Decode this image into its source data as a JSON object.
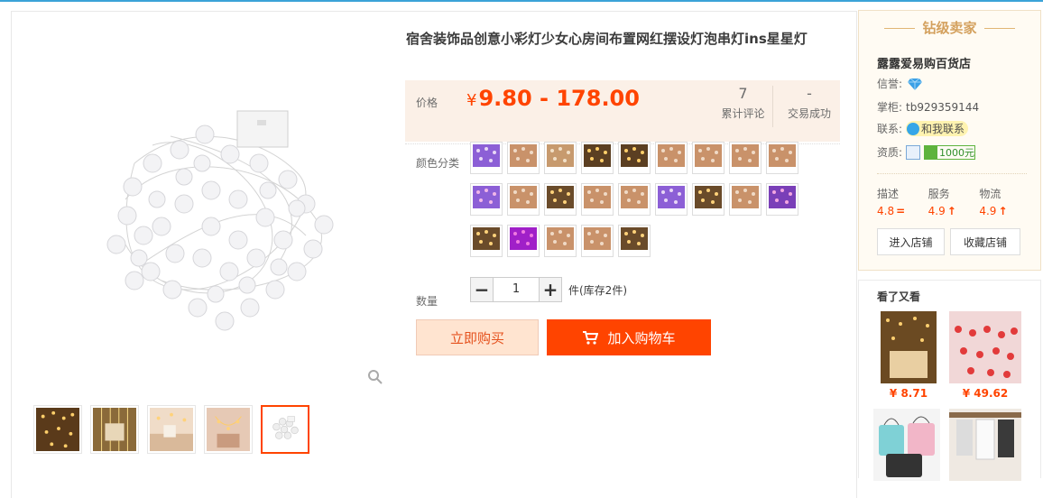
{
  "product": {
    "title": "宿舍装饰品创意小彩灯少女心房间布置网红摆设灯泡串灯ins星星灯",
    "price_label": "价格",
    "currency": "¥",
    "price_range": "9.80 - 178.00",
    "reviews_count": "7",
    "reviews_label": "累计评论",
    "sales_value": "-",
    "sales_label": "交易成功",
    "sku_label": "颜色分类",
    "sku_count": 23,
    "quantity_label": "数量",
    "quantity_value": "1",
    "stock_text": "件(库存2件)",
    "buy_now_label": "立即购买",
    "add_to_cart_label": "加入购物车"
  },
  "gallery": {
    "thumb_count": 5,
    "active_thumb_index": 4
  },
  "seller": {
    "badge": "钻级卖家",
    "shop_name": "露露爱易购百货店",
    "credit_label": "信誉:",
    "owner_label": "掌柜:",
    "owner": "tb929359144",
    "contact_label": "联系:",
    "contact_button": "和我联系",
    "qualification_label": "资质:",
    "deposit": "1000元",
    "scores": [
      {
        "label": "描述",
        "value": "4.8",
        "trend": "="
      },
      {
        "label": "服务",
        "value": "4.9",
        "trend": "↑"
      },
      {
        "label": "物流",
        "value": "4.9",
        "trend": "↑"
      }
    ],
    "enter_shop": "进入店铺",
    "favorite_shop": "收藏店铺"
  },
  "also_viewed": {
    "title": "看了又看",
    "items": [
      {
        "price": "¥ 8.71"
      },
      {
        "price": "¥ 49.62"
      },
      {
        "price": ""
      },
      {
        "price": ""
      }
    ]
  },
  "colors": {
    "accent": "#ff4400",
    "price_bg": "#fbf0e7",
    "seller_gold": "#d4a15e"
  }
}
